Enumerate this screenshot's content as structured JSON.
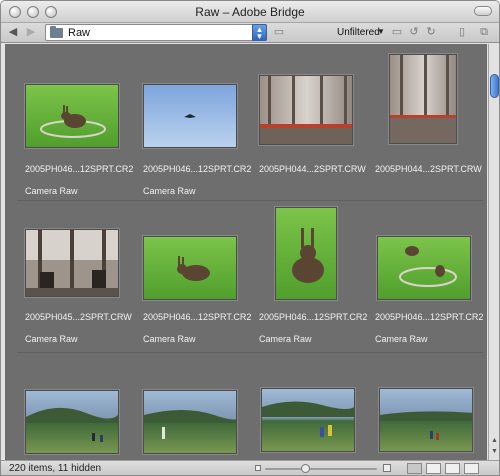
{
  "window": {
    "title": "Raw – Adobe Bridge"
  },
  "toolbar": {
    "back_icon": "back-arrow-icon",
    "forward_icon": "forward-arrow-icon",
    "path": "Raw",
    "filter": "Unfiltered"
  },
  "content": {
    "rows": [
      [
        {
          "filename": "2005PH046...12SPRT.CR2",
          "label": "Camera Raw"
        },
        {
          "filename": "2005PH046...12SPRT.CR2",
          "label": "Camera Raw"
        },
        {
          "filename": "2005PH044...2SPRT.CRW",
          "label": ""
        },
        {
          "filename": "2005PH044...2SPRT.CRW",
          "label": ""
        }
      ],
      [
        {
          "filename": "2005PH045...2SPRT.CRW",
          "label": "Camera Raw"
        },
        {
          "filename": "2005PH046...12SPRT.CR2",
          "label": "Camera Raw"
        },
        {
          "filename": "2005PH046...12SPRT.CR2",
          "label": "Camera Raw"
        },
        {
          "filename": "2005PH046...12SPRT.CR2",
          "label": "Camera Raw"
        }
      ],
      [
        {
          "filename": "",
          "label": ""
        },
        {
          "filename": "",
          "label": ""
        },
        {
          "filename": "",
          "label": ""
        },
        {
          "filename": "",
          "label": ""
        }
      ]
    ]
  },
  "status": {
    "text": "220 items, 11 hidden",
    "thumbnail_size": 0.35
  },
  "colors": {
    "content_bg": "#6e6e6e",
    "accent": "#3c78d6"
  }
}
